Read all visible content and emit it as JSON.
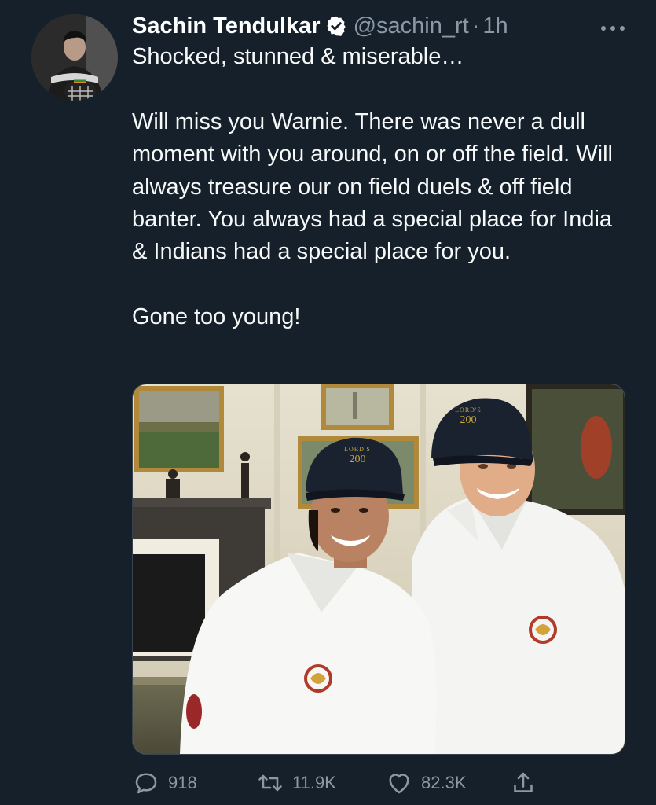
{
  "tweet": {
    "author": {
      "name": "Sachin Tendulkar",
      "handle": "@sachin_rt",
      "verified": true
    },
    "separator": "·",
    "time": "1h",
    "text": {
      "line1": "Shocked, stunned & miserable…",
      "paragraph2": "Will miss you Warnie. There was never a dull moment with you around, on or off the field. Will always treasure our on field duels & off field banter. You always had a special place for India & Indians had a special place for you.",
      "paragraph3": "Gone too young!"
    },
    "media": {
      "cap_badge_text": "200",
      "cap_arc_text": "LORD'S"
    },
    "stats": {
      "replies": "918",
      "retweets": "11.9K",
      "likes": "82.3K"
    }
  },
  "icons": {
    "verified": "verified-badge-icon",
    "more": "more-options-icon",
    "reply": "reply-icon",
    "retweet": "retweet-icon",
    "like": "heart-icon",
    "share": "share-icon"
  },
  "colors": {
    "background": "#15202b",
    "text_primary": "#f7f9f9",
    "text_secondary": "#8b98a5",
    "divider": "#38444d"
  }
}
